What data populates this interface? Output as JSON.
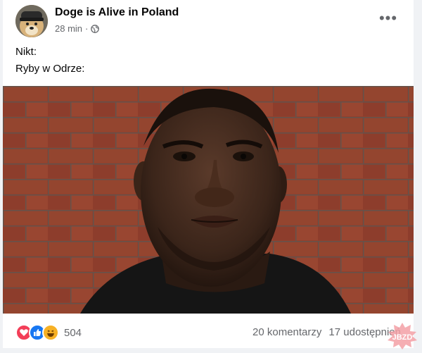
{
  "post": {
    "author": "Doge is Alive in Poland",
    "time": "28 min",
    "privacy_icon": "globe-icon",
    "more_label": "•••",
    "text_lines": [
      "Nikt:",
      "Ryby w Odrze:"
    ],
    "image_alt": "selfie of a man in front of a red brick wall"
  },
  "footer": {
    "reaction_icons": [
      "love-icon",
      "like-icon",
      "haha-icon"
    ],
    "reaction_count": "504",
    "comments": "20 komentarzy",
    "shares": "17 udostępnień"
  },
  "colors": {
    "secondary_text": "#65676b",
    "love": "#f33e58",
    "like": "#1877f2",
    "haha": "#f7b125"
  }
}
